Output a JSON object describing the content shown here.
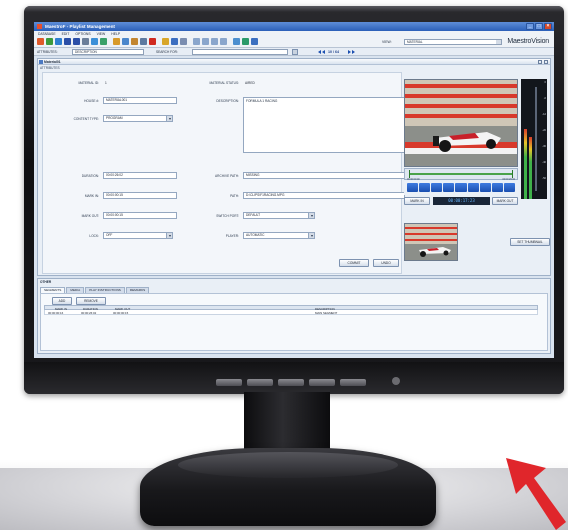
{
  "window": {
    "title": "MaestroF - Playlist Management",
    "controls": [
      "_",
      "□",
      "×"
    ]
  },
  "menubar": [
    "Database",
    "Edit",
    "Options",
    "View",
    "Help"
  ],
  "toolbar": {
    "view_label": "View:",
    "view_value": "Material",
    "brand": "MaestroVision"
  },
  "searchbar": {
    "attributes_label": "Attributes:",
    "attributes_value": "Description",
    "search_label": "Search For:",
    "search_value": "",
    "record_counter": "10 / 64"
  },
  "document": {
    "tab_title": "Material01",
    "section_label": "Attributes",
    "fields": {
      "material_id_label": "Material ID:",
      "material_id_value": "1",
      "material_status_label": "Material Status:",
      "material_status_value": "Aired",
      "house_id_label": "House #:",
      "house_id_value": "Material001",
      "description_label": "Description:",
      "description_value": "Formula 1 Racing",
      "content_type_label": "Content Type:",
      "content_type_value": "Program",
      "duration_label": "Duration:",
      "duration_value": "00:00:26:02",
      "archive_path_label": "Archive Path:",
      "archive_path_value": "Missing",
      "mark_in_label": "Mark In:",
      "mark_in_value": "00:00:00:15",
      "path_label": "Path:",
      "path_value": "D:\\Clips\\F1Racing.mpg",
      "mark_out_label": "Mark Out:",
      "mark_out_value": "00:00:00:15",
      "switch_port_label": "Switch Port:",
      "switch_port_value": "Default",
      "lock_label": "Lock:",
      "lock_value": "Off",
      "player_label": "Player:",
      "player_value": "Automatic"
    },
    "buttons": {
      "commit": "Commit",
      "undo": "Undo",
      "mark_in": "Mark In",
      "mark_out": "Mark Out",
      "set_thumbnail": "Set Thumbnail"
    },
    "timeline": {
      "start_tc": "00:00:00:00",
      "end_tc": "00:00:26:02"
    },
    "current_timecode": "00:00:17:23",
    "meter_scale": [
      "0",
      "-6",
      "-12",
      "-20",
      "-30",
      "-40",
      "-50"
    ]
  },
  "other": {
    "section_label": "Other",
    "tabs": [
      "Segments",
      "Media",
      "Play Instructions",
      "Remarks"
    ],
    "buttons": {
      "add": "Add",
      "remove": "Remove"
    },
    "columns": [
      "Mark In",
      "Duration",
      "Mark Out",
      "Description"
    ],
    "rows": [
      [
        "00:00:00:16",
        "00:00:26:02",
        "00:00:00:15",
        "Main segment"
      ]
    ]
  },
  "colors": {
    "titlebar": "#2b5fb8",
    "panel": "#e9eff6",
    "transport_button": "#1a4fb0",
    "timecode_text": "#66b7ff",
    "arrow": "#e0262b"
  },
  "icons": [
    "app-icon",
    "new-icon",
    "open-icon",
    "save-icon",
    "print-icon",
    "cut-icon",
    "delete-icon",
    "calendar-icon",
    "web-icon",
    "search-icon"
  ]
}
